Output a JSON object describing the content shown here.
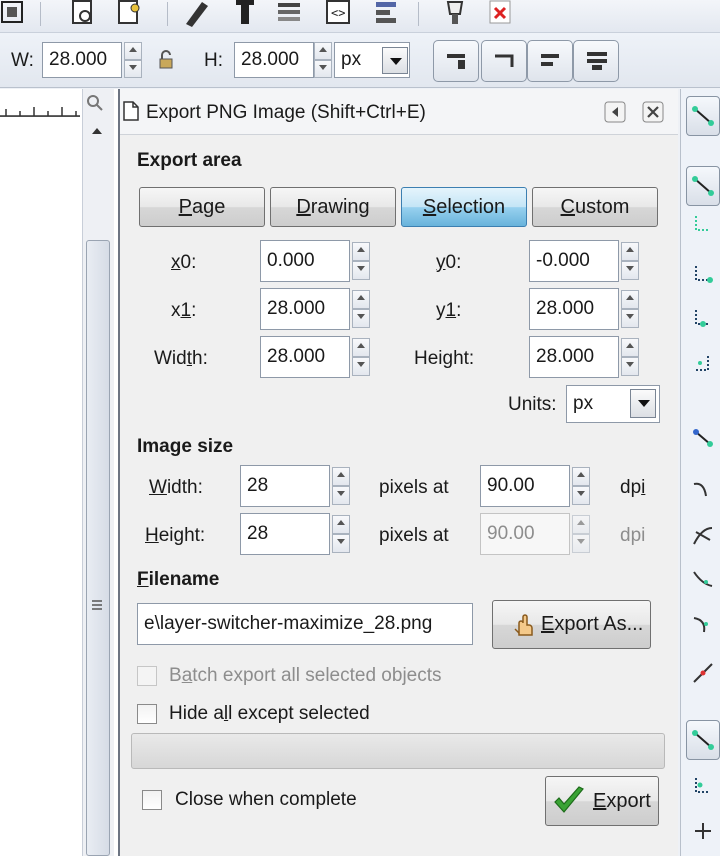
{
  "controls": {
    "w_label": "W:",
    "w_value": "28.000",
    "h_label": "H:",
    "h_value": "28.000",
    "unit": "px"
  },
  "dialog": {
    "title": "Export PNG Image (Shift+Ctrl+E)",
    "export_area": {
      "heading": "Export area",
      "buttons": {
        "page": {
          "pre": "",
          "key": "P",
          "post": "age"
        },
        "drawing": {
          "pre": "",
          "key": "D",
          "post": "rawing"
        },
        "selection": {
          "pre": "",
          "key": "S",
          "post": "election"
        },
        "custom": {
          "pre": "",
          "key": "C",
          "post": "ustom"
        }
      },
      "selected": "selection",
      "x0": {
        "pre": "",
        "key": "x",
        "post": "0:",
        "value": "0.000"
      },
      "y0": {
        "pre": "",
        "key": "y",
        "post": "0:",
        "value": "-0.000"
      },
      "x1": {
        "pre": "x",
        "key": "1",
        "post": ":",
        "value": "28.000"
      },
      "y1": {
        "pre": "y",
        "key": "1",
        "post": ":",
        "value": "28.000"
      },
      "width": {
        "pre": "Wid",
        "key": "t",
        "post": "h:",
        "value": "28.000"
      },
      "height": {
        "label": "Height:",
        "value": "28.000"
      },
      "units_label": "Units:",
      "units_value": "px"
    },
    "image_size": {
      "heading": "Image size",
      "width": {
        "pre": "",
        "key": "W",
        "post": "idth:",
        "value": "28",
        "pixels_at": "pixels at",
        "dpi_value": "90.00",
        "dpi_pre": "dp",
        "dpi_key": "i",
        "dpi_post": ""
      },
      "height": {
        "pre": "",
        "key": "H",
        "post": "eight:",
        "value": "28",
        "pixels_at": "pixels at",
        "dpi_value": "90.00",
        "dpi": "dpi"
      }
    },
    "filename": {
      "heading_pre": "",
      "heading_key": "F",
      "heading_post": "ilename",
      "value": "e\\layer-switcher-maximize_28.png",
      "export_as": {
        "pre": "",
        "key": "E",
        "post": "xport As..."
      }
    },
    "batch_export": {
      "pre": "B",
      "key": "a",
      "post": "tch export all selected objects"
    },
    "hide_all": {
      "pre": "Hide a",
      "key": "l",
      "post": "l except selected"
    },
    "close_when_complete": "Close when complete",
    "export_button": {
      "pre": "",
      "key": "E",
      "post": "xport"
    }
  },
  "colors": {
    "selected_button": "#98d1ef",
    "check_green": "#3aa335",
    "title_bg": "#f4f5f7"
  }
}
